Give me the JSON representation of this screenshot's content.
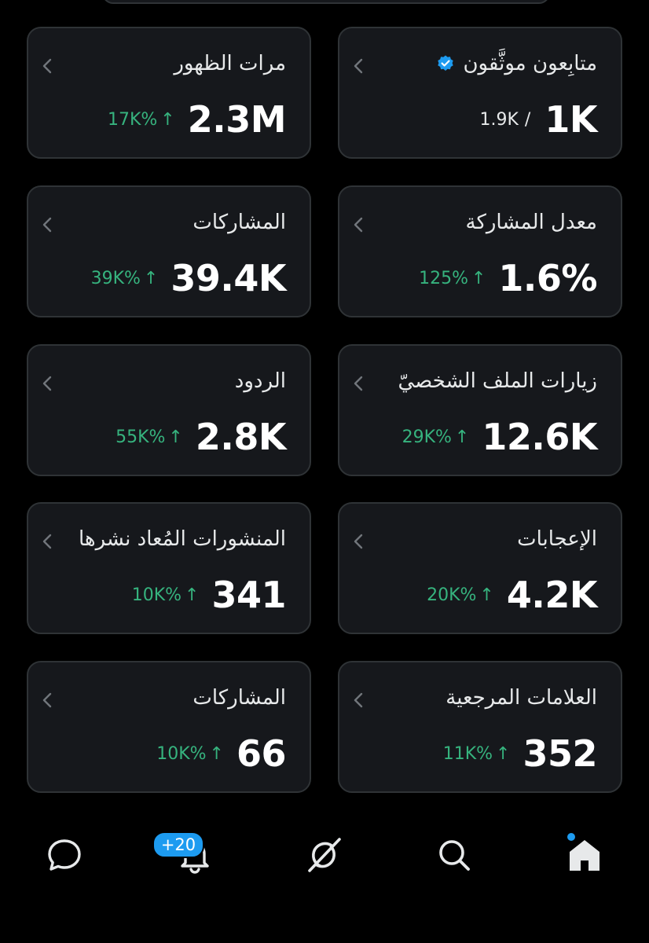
{
  "cards": [
    {
      "title": "متابِعون موثَّقون",
      "verified": true,
      "value": "1K",
      "total": "1.9K",
      "separator": "/"
    },
    {
      "title": "مرات الظهور",
      "value": "2.3M",
      "change": "17K%",
      "arrow": "↑"
    },
    {
      "title": "معدل المشاركة",
      "value": "1.6%",
      "change": "125%",
      "arrow": "↑"
    },
    {
      "title": "المشاركات",
      "value": "39.4K",
      "change": "39K%",
      "arrow": "↑"
    },
    {
      "title": "زيارات الملف الشخصيّ",
      "value": "12.6K",
      "change": "29K%",
      "arrow": "↑"
    },
    {
      "title": "الردود",
      "value": "2.8K",
      "change": "55K%",
      "arrow": "↑"
    },
    {
      "title": "الإعجابات",
      "value": "4.2K",
      "change": "20K%",
      "arrow": "↑"
    },
    {
      "title": "المنشورات المُعاد نشرها",
      "value": "341",
      "change": "10K%",
      "arrow": "↑"
    },
    {
      "title": "العلامات المرجعية",
      "value": "352",
      "change": "11K%",
      "arrow": "↑"
    },
    {
      "title": "المشاركات",
      "value": "66",
      "change": "10K%",
      "arrow": "↑"
    }
  ],
  "nav": {
    "items": [
      {
        "name": "messages",
        "icon": "chat-bubble-icon"
      },
      {
        "name": "notifications",
        "icon": "bell-icon",
        "badge": "+20"
      },
      {
        "name": "grok",
        "icon": "grok-icon"
      },
      {
        "name": "search",
        "icon": "search-icon"
      },
      {
        "name": "home",
        "icon": "home-icon",
        "has_unread_dot": true
      }
    ]
  },
  "colors": {
    "background": "#000000",
    "card": "#16181c",
    "card_border": "#2f3336",
    "positive": "#36b37e",
    "accent": "#1d9bf0",
    "text": "#e7e9ea"
  }
}
